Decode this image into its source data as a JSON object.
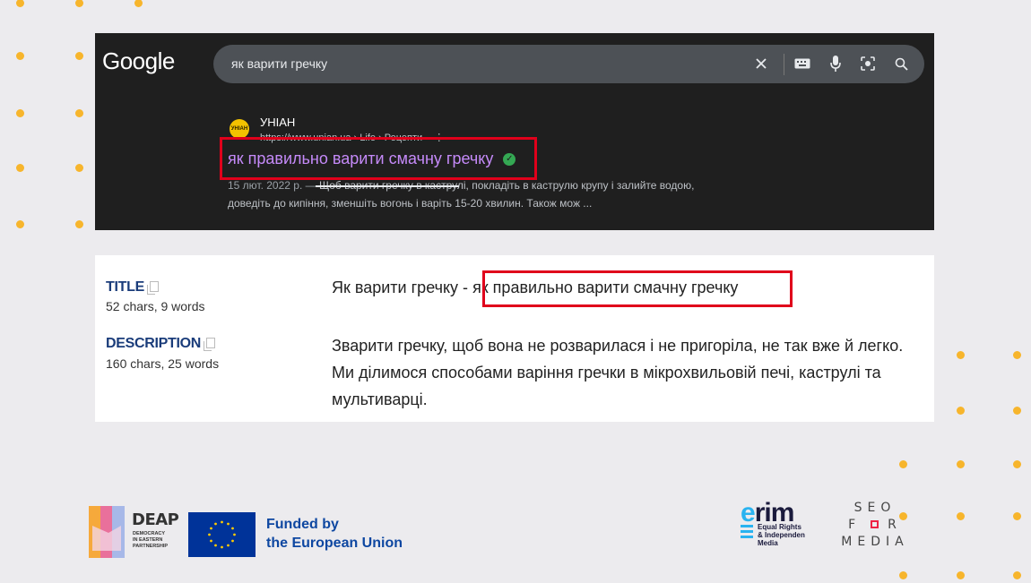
{
  "google": {
    "logo": "Google",
    "query": "як варити гречку"
  },
  "result": {
    "site": "УНІАН",
    "favicon_text": "УНІАН",
    "url": "https://www.unian.ua › Life › Рецепти",
    "url_more": "⋮",
    "title": "як правильно варити смачну гречку",
    "date": "15 лют. 2022 р. —",
    "snippet_line1": " Щоб варити гречку в каструлі, покладіть в каструлю крупу і залийте водою,",
    "snippet_line2": "доведіть до кипіння, зменшіть вогонь і варіть 15-20 хвилин. Також мож ..."
  },
  "meta": {
    "title_label": "TITLE",
    "title_count": "52 chars, 9 words",
    "title_prefix": "Як варити гречку - ",
    "title_highlight": "як правильно варити смачну гречку",
    "description_label": "DESCRIPTION",
    "description_count": "160 chars, 25 words",
    "description_text": "Зварити гречку, щоб вона не розварилася і не пригоріла, не так вже й легко. Ми ділимося способами варіння гречки в мікрохвильовій печі, каструлі та мультиварці."
  },
  "footer": {
    "deap_name": "DEAP",
    "deap_sub": "DEMOCRACY IN EASTERN PARTNERSHIP",
    "funded_line1": "Funded by",
    "funded_line2": "the European Union",
    "erim_word": "rim",
    "erim_e": "e",
    "erim_sub1": "Equal Rights",
    "erim_sub2": "& Independen",
    "erim_sub3": "Media",
    "seo_line1": "SEO",
    "seo_line2_a": "F",
    "seo_line2_b": "R",
    "seo_line3": "MEDIA"
  },
  "colors": {
    "background": "#ecebee",
    "dots": "#f7b52c",
    "highlight": "#e0001b",
    "result_title": "#c58af9",
    "label": "#1a3c7a"
  }
}
